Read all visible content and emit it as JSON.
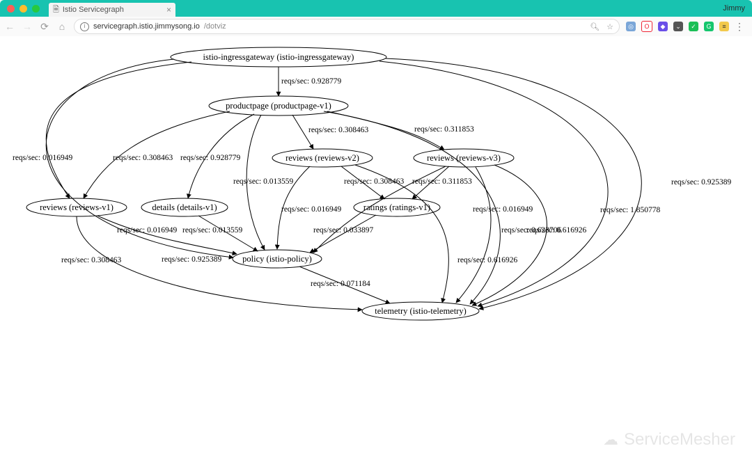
{
  "window": {
    "profile_name": "Jimmy",
    "tab": {
      "title": "Istio Servicegraph"
    }
  },
  "toolbar": {
    "url_host": "servicegraph.istio.jimmysong.io",
    "url_path": "/dotviz"
  },
  "watermark": {
    "label": "ServiceMesher"
  },
  "chart_data": {
    "type": "graph",
    "directed": true,
    "nodes": [
      {
        "id": "ingress",
        "label": "istio-ingressgateway (istio-ingressgateway)"
      },
      {
        "id": "productpage",
        "label": "productpage (productpage-v1)"
      },
      {
        "id": "reviews-v2",
        "label": "reviews (reviews-v2)"
      },
      {
        "id": "reviews-v3",
        "label": "reviews (reviews-v3)"
      },
      {
        "id": "reviews-v1",
        "label": "reviews (reviews-v1)"
      },
      {
        "id": "details",
        "label": "details (details-v1)"
      },
      {
        "id": "ratings",
        "label": "ratings (ratings-v1)"
      },
      {
        "id": "policy",
        "label": "policy (istio-policy)"
      },
      {
        "id": "telemetry",
        "label": "telemetry (istio-telemetry)"
      }
    ],
    "edges": [
      {
        "id": "e1",
        "from": "ingress",
        "to": "productpage",
        "reqs_sec": 0.928779
      },
      {
        "id": "e2",
        "from": "ingress",
        "to": "reviews-v1",
        "reqs_sec": 0.016949
      },
      {
        "id": "e3",
        "from": "ingress",
        "to": "policy",
        "reqs_sec": 0.925389
      },
      {
        "id": "e4",
        "from": "ingress",
        "to": "telemetry",
        "reqs_sec": 1.850778
      },
      {
        "id": "e5",
        "from": "ingress",
        "to": "telemetry",
        "reqs_sec": 0.925389
      },
      {
        "id": "e6",
        "from": "productpage",
        "to": "reviews-v2",
        "reqs_sec": 0.308463
      },
      {
        "id": "e7",
        "from": "productpage",
        "to": "reviews-v3",
        "reqs_sec": 0.311853
      },
      {
        "id": "e8",
        "from": "productpage",
        "to": "reviews-v1",
        "reqs_sec": 0.308463
      },
      {
        "id": "e9",
        "from": "productpage",
        "to": "details",
        "reqs_sec": 0.928779
      },
      {
        "id": "e10",
        "from": "productpage",
        "to": "policy",
        "reqs_sec": 0.013559
      },
      {
        "id": "e11",
        "from": "productpage",
        "to": "telemetry",
        "reqs_sec": 0.016949
      },
      {
        "id": "e12",
        "from": "reviews-v2",
        "to": "ratings",
        "reqs_sec": 0.308463
      },
      {
        "id": "e13",
        "from": "reviews-v2",
        "to": "policy",
        "reqs_sec": 0.016949
      },
      {
        "id": "e14",
        "from": "reviews-v2",
        "to": "telemetry",
        "reqs_sec": 0.616926
      },
      {
        "id": "e15",
        "from": "reviews-v3",
        "to": "ratings",
        "reqs_sec": 0.311853
      },
      {
        "id": "e16",
        "from": "reviews-v3",
        "to": "policy",
        "reqs_sec": 0.016949
      },
      {
        "id": "e17",
        "from": "reviews-v3",
        "to": "telemetry",
        "reqs_sec": 0.623706
      },
      {
        "id": "e18",
        "from": "reviews-v3",
        "to": "telemetry",
        "reqs_sec": 0.616926
      },
      {
        "id": "e19",
        "from": "reviews-v1",
        "to": "policy",
        "reqs_sec": 0.016949
      },
      {
        "id": "e20",
        "from": "reviews-v1",
        "to": "telemetry",
        "reqs_sec": 0.308463
      },
      {
        "id": "e21",
        "from": "details",
        "to": "policy",
        "reqs_sec": 0.013559
      },
      {
        "id": "e22",
        "from": "ratings",
        "to": "policy",
        "reqs_sec": 0.033897
      },
      {
        "id": "e23",
        "from": "policy",
        "to": "telemetry",
        "reqs_sec": 0.071184
      }
    ]
  }
}
